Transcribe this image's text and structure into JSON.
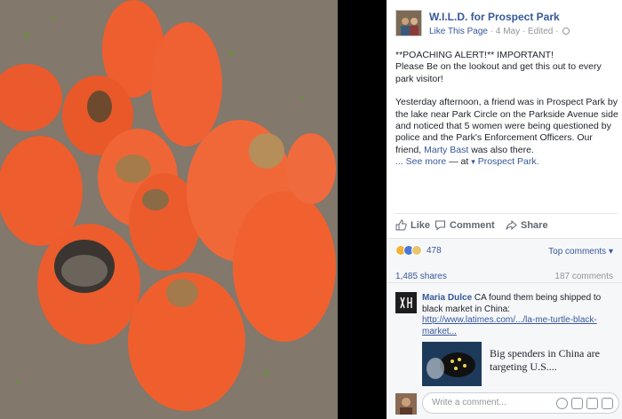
{
  "page": {
    "name": "W.I.L.D. for Prospect Park",
    "like_label": "Like This Page",
    "date": "4 May",
    "edited": "Edited"
  },
  "post": {
    "line1": "**POACHING ALERT!** IMPORTANT!",
    "line2": "Please Be on the lookout and get this out to every park visitor!",
    "para2": "Yesterday afternoon, a friend was in Prospect Park by the lake near Park Circle on the Parkside Avenue side and noticed that 5 women were being questioned by police and the Park's Enforcement Officers. Our friend,",
    "tagged_friend": "Marty Bast",
    "para2_end": "was also there.",
    "see_more": "... See more",
    "at_text": "— at",
    "location": "Prospect Park."
  },
  "actions": {
    "like": "Like",
    "comment": "Comment",
    "share": "Share"
  },
  "summary": {
    "reaction_count": "478",
    "top_comments": "Top comments",
    "shares": "1,485 shares",
    "comments": "187 comments"
  },
  "comment": {
    "author": "Maria Dulce",
    "text": "CA found them being shipped to black market in China:",
    "link": "http://www.latimes.com/.../la-me-turtle-black-market...",
    "card_title": "Big spenders in China are targeting U.S...."
  },
  "composer": {
    "placeholder": "Write a comment..."
  },
  "colors": {
    "link": "#365899",
    "bag": "#ee5a2c",
    "ground": "#7d7467"
  }
}
